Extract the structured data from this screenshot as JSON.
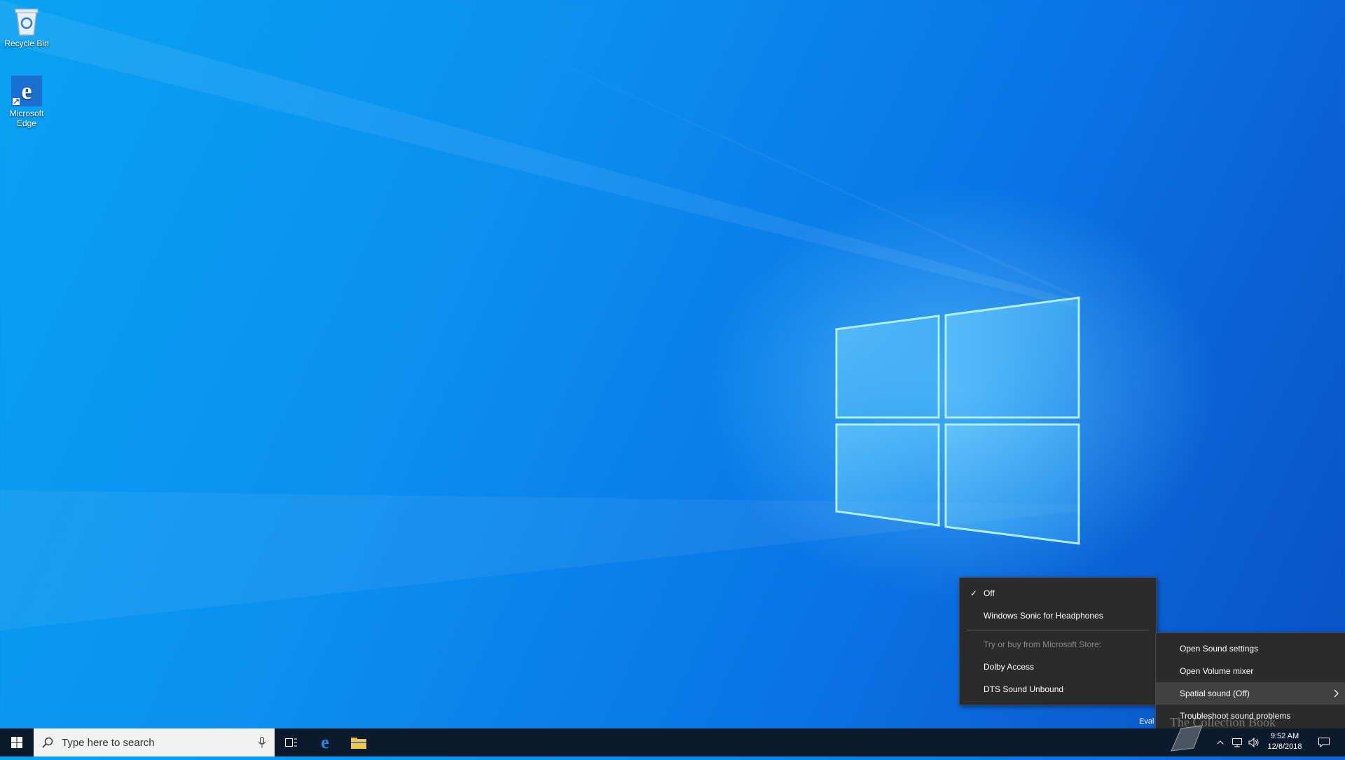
{
  "desktop": {
    "icons": [
      {
        "label": "Recycle Bin",
        "icon": "recycle-bin-icon"
      },
      {
        "label": "Microsoft Edge",
        "icon": "edge-icon"
      }
    ]
  },
  "spatial_submenu": {
    "items": [
      {
        "label": "Off",
        "checked": true
      },
      {
        "label": "Windows Sonic for Headphones"
      }
    ],
    "store_header": "Try or buy from Microsoft Store:",
    "store_items": [
      {
        "label": "Dolby Access"
      },
      {
        "label": "DTS Sound Unbound"
      }
    ]
  },
  "sound_menu": {
    "items": [
      {
        "label": "Open Sound settings"
      },
      {
        "label": "Open Volume mixer"
      },
      {
        "label": "Spatial sound (Off)"
      },
      {
        "label": "Troubleshoot sound problems"
      }
    ]
  },
  "taskbar": {
    "search_placeholder": "Type here to search",
    "pinned": [
      "task-view-icon",
      "edge-icon",
      "file-explorer-icon"
    ],
    "tray": {
      "time": "9:52 AM",
      "date": "12/6/2018"
    },
    "eval_text": "Eval"
  },
  "watermark": "The Collection Book",
  "colors": {
    "menu_bg": "#2b2b2b",
    "menu_highlight": "#414141",
    "taskbar_bg": "#0c1a2e",
    "accent": "#0078d7"
  }
}
